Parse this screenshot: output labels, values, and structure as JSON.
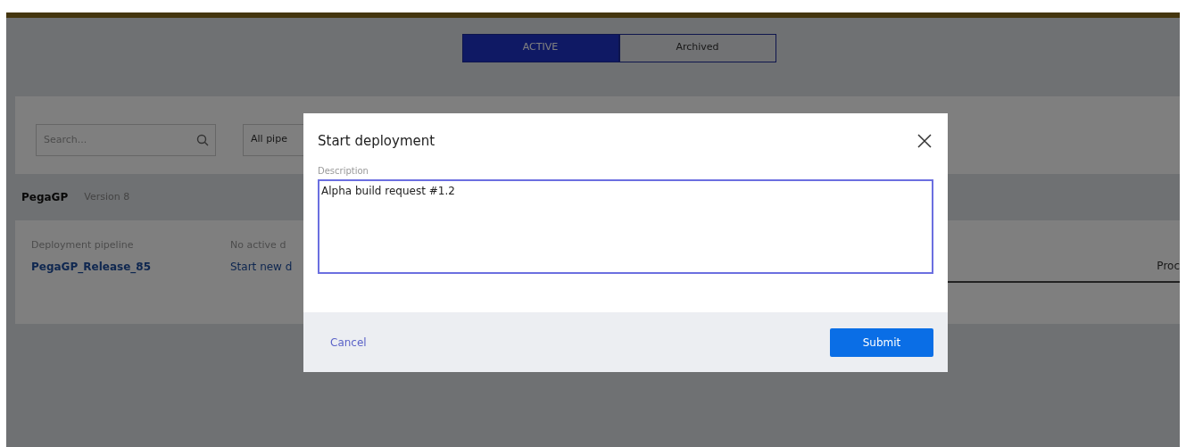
{
  "tabs": [
    {
      "label": "ACTIVE",
      "selected": true
    },
    {
      "label": "Archived",
      "selected": false
    }
  ],
  "filters": {
    "search": {
      "placeholder": "Search..."
    },
    "pipeline_filter": "All pipe"
  },
  "application": {
    "name": "PegaGP",
    "version_label": "Version",
    "version": "8"
  },
  "pipeline_card": {
    "pipeline_label": "Deployment pipeline",
    "pipeline_link": "PegaGP_Release_85",
    "status_label": "No active d",
    "start_link": "Start new d",
    "column_3": "Proc"
  },
  "modal": {
    "title": "Start deployment",
    "description_label": "Description",
    "description_value": "Alpha build request #1.2",
    "cancel": "Cancel",
    "submit": "Submit"
  }
}
